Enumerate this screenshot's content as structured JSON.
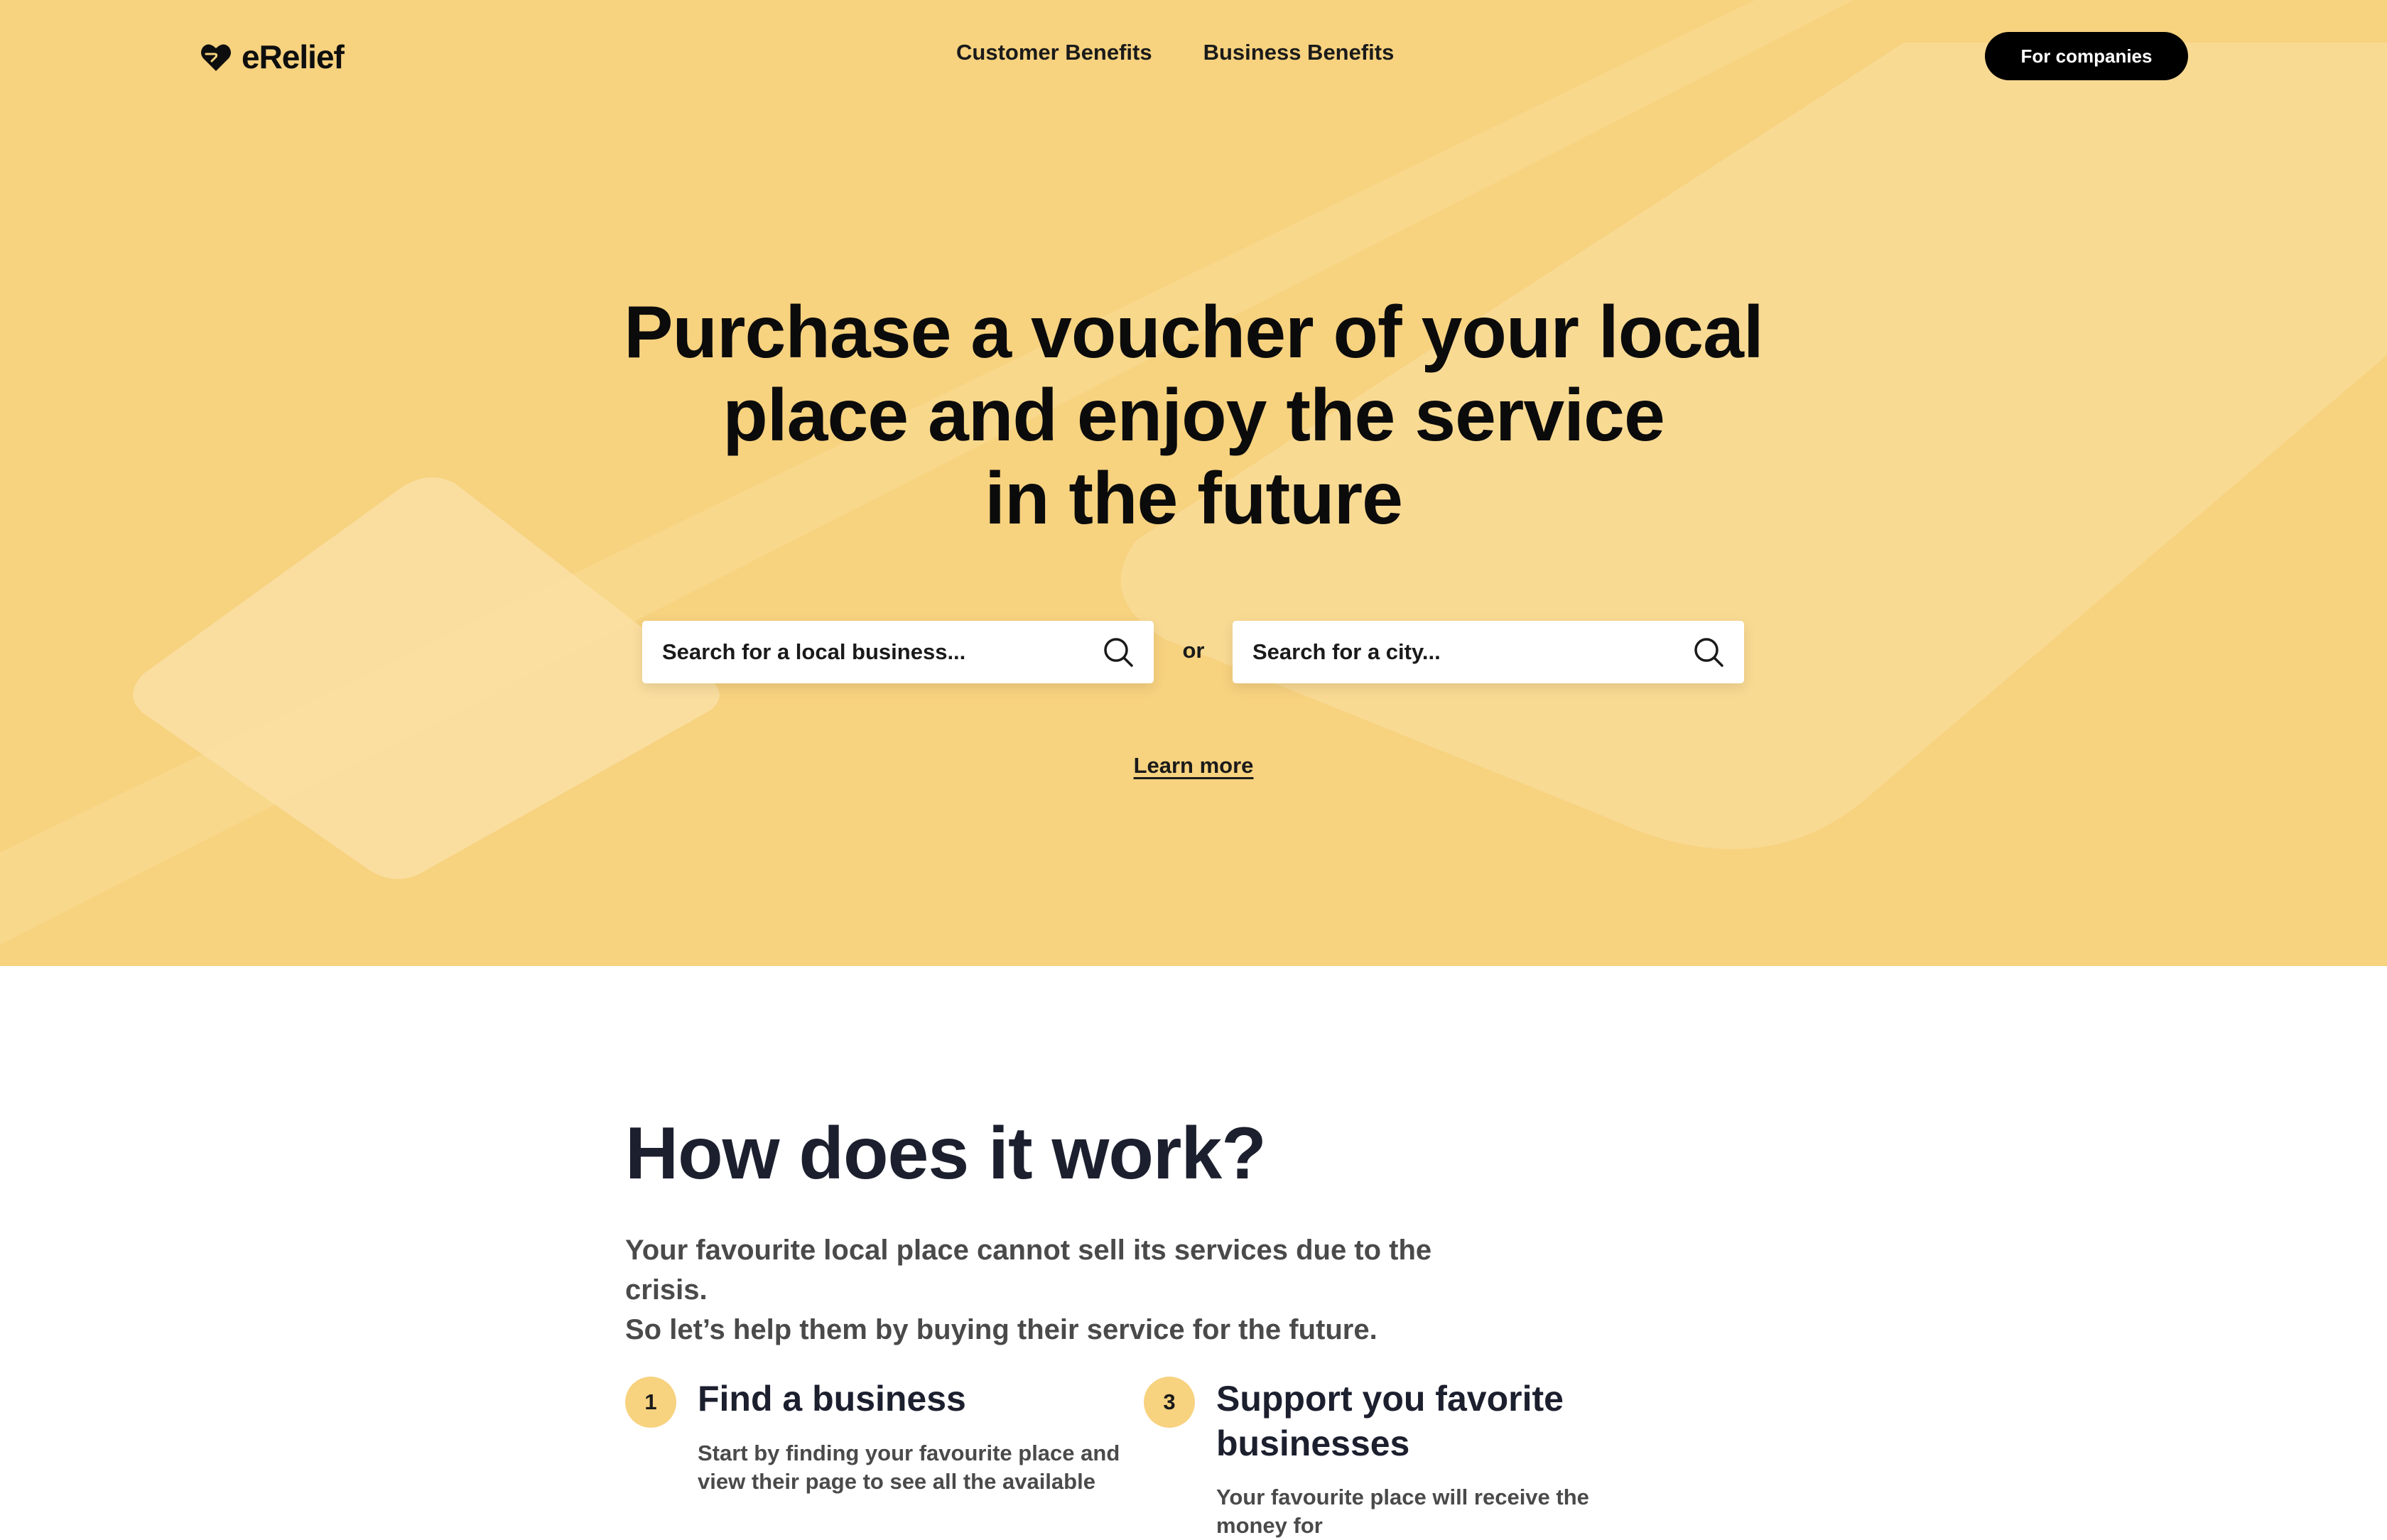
{
  "brand": {
    "name": "eRelief",
    "logo_icon": "heart-hand-icon"
  },
  "nav": {
    "links": [
      "Customer Benefits",
      "Business Benefits"
    ],
    "cta_label": "For companies"
  },
  "hero": {
    "title_lines": [
      "Purchase a voucher of your local",
      "place and enjoy the service",
      "in the future"
    ],
    "search_business_placeholder": "Search for a local business...",
    "search_city_placeholder": "Search for a city...",
    "search_icon": "search-icon",
    "separator": "or",
    "learn_more": "Learn more"
  },
  "how": {
    "title": "How does it work?",
    "intro_lines": [
      "Your favourite local place cannot sell its services due to the crisis.",
      "So let’s help them by buying their service for the future."
    ],
    "steps": [
      {
        "number": "1",
        "title": "Find a business",
        "text_lines": [
          "Start by finding your favourite place and",
          "view their page to see all the available"
        ]
      },
      {
        "number": "3",
        "title": "Support you favorite businesses",
        "text_lines": [
          "Your favourite place will receive the money for"
        ]
      }
    ]
  },
  "colors": {
    "hero_background": "#f7d27f",
    "cta_background": "#000000",
    "heading_dark": "#1c1f2e",
    "badge_background": "#f7d27f"
  }
}
